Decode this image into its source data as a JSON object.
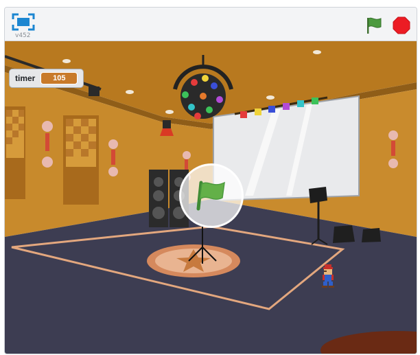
{
  "player": {
    "version": "v452",
    "controls": {
      "fullscreen_icon": "fullscreen-icon",
      "green_flag_icon": "green-flag-icon",
      "stop_icon": "stop-sign-icon"
    },
    "colors": {
      "flag_green": "#4c9a3f",
      "stop_red": "#ec1c24",
      "fullscreen_blue": "#1c86d1"
    }
  },
  "stage": {
    "monitor": {
      "label": "timer",
      "value": "105"
    },
    "start_overlay_icon": "green-flag-icon",
    "colors": {
      "wall": "#c88a2c",
      "ceiling": "#b8791f",
      "floor": "#3d3d52",
      "carpet_line": "#e3a77e"
    }
  }
}
